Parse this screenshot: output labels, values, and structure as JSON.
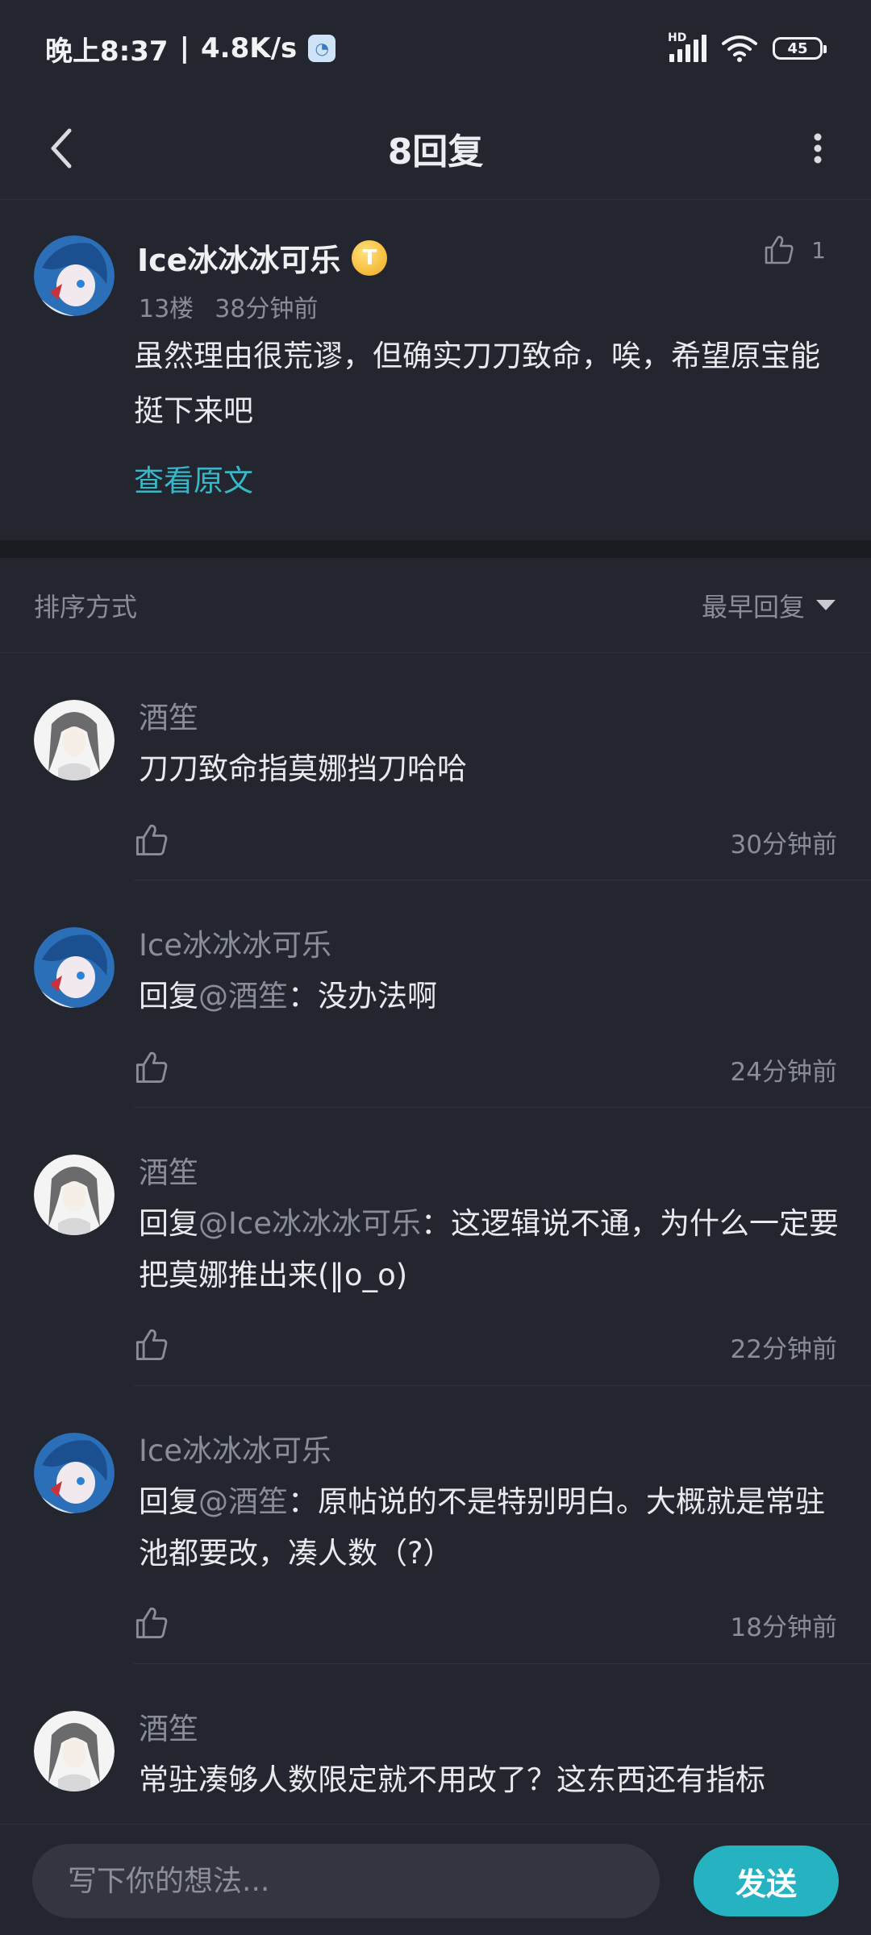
{
  "status_bar": {
    "time": "晚上8:37",
    "network_speed": "4.8K/s",
    "signal_label": "HD",
    "battery": "45"
  },
  "header": {
    "title": "8回复"
  },
  "post": {
    "author": "Ice冰冰冰可乐",
    "badge": "T",
    "floor": "13楼",
    "time": "38分钟前",
    "likes": "1",
    "content": "虽然理由很荒谬，但确实刀刀致命，唉，希望原宝能挺下来吧",
    "view_original": "查看原文"
  },
  "sort": {
    "label": "排序方式",
    "selected": "最早回复"
  },
  "replies": [
    {
      "author": "酒笙",
      "mention": "",
      "text": "刀刀致命指莫娜挡刀哈哈",
      "time": "30分钟前"
    },
    {
      "author": "Ice冰冰冰可乐",
      "reply_prefix": "回复",
      "mention": "@酒笙",
      "text": "：没办法啊",
      "time": "24分钟前"
    },
    {
      "author": "酒笙",
      "reply_prefix": "回复",
      "mention": "@Ice冰冰冰可乐",
      "text": "：这逻辑说不通，为什么一定要把莫娜推出来(‖o_o)",
      "time": "22分钟前"
    },
    {
      "author": "Ice冰冰冰可乐",
      "reply_prefix": "回复",
      "mention": "@酒笙",
      "text": "：原帖说的不是特别明白。大概就是常驻池都要改，凑人数（?）",
      "time": "18分钟前"
    },
    {
      "author": "酒笙",
      "mention": "",
      "text": "常驻凑够人数限定就不用改了？这东西还有指标",
      "time": ""
    }
  ],
  "input": {
    "placeholder": "写下你的想法...",
    "send_label": "发送"
  }
}
